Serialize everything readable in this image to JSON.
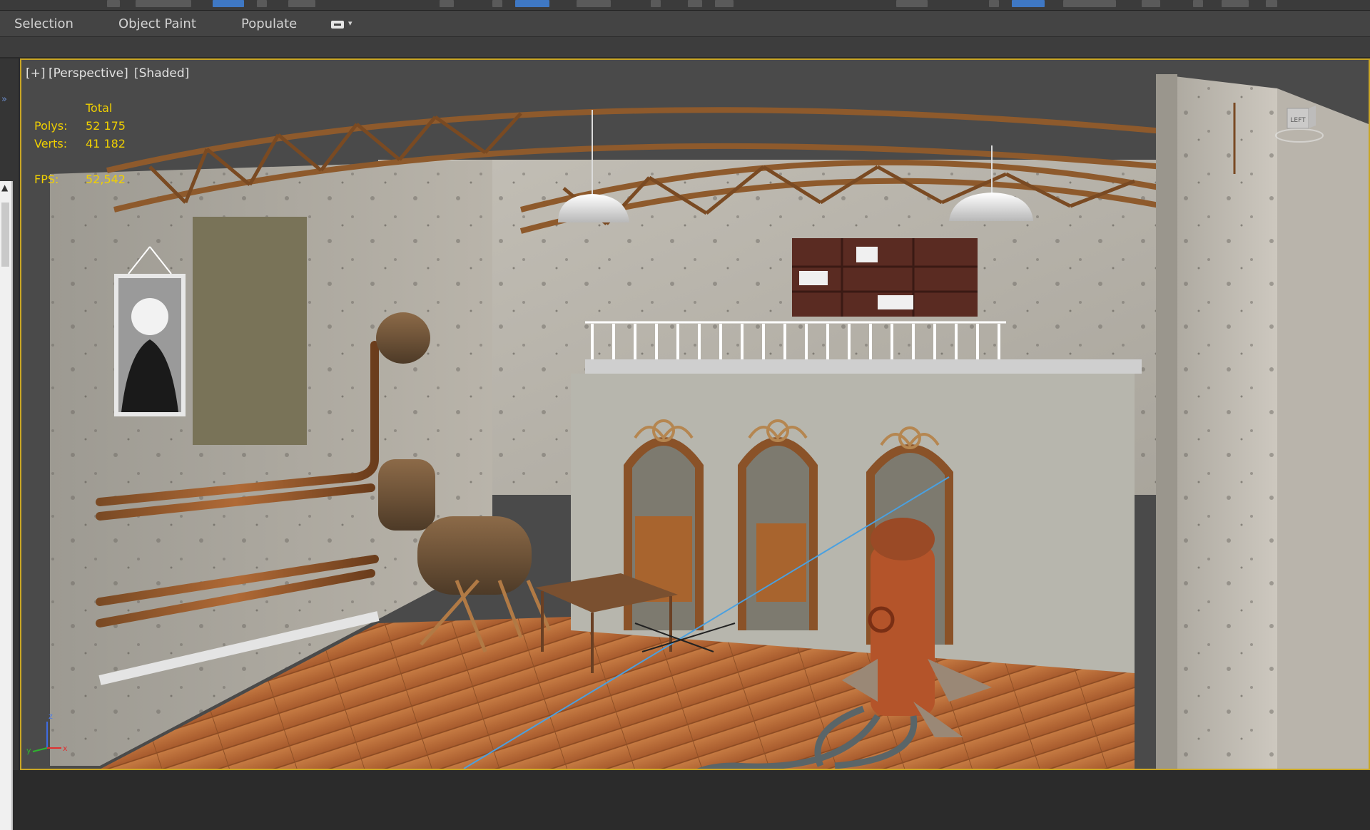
{
  "ribbon": {
    "tabs": [
      "Selection",
      "Object Paint",
      "Populate"
    ],
    "options_icon": "keyboard-dropdown-icon"
  },
  "viewport": {
    "labels": [
      "[+]",
      "[Perspective]",
      "[Shaded]"
    ],
    "stats": {
      "header": "Total",
      "polys_label": "Polys:",
      "polys_value": "52 175",
      "verts_label": "Verts:",
      "verts_value": "41 182",
      "fps_label": "FPS:",
      "fps_value": "52,542"
    },
    "viewcube_label": "LEFT",
    "axes": {
      "x": "x",
      "y": "y",
      "z": "z"
    }
  },
  "colors": {
    "accent_border": "#c9a624",
    "stats_text": "#f0d000",
    "active_tool": "#3f78c4"
  }
}
